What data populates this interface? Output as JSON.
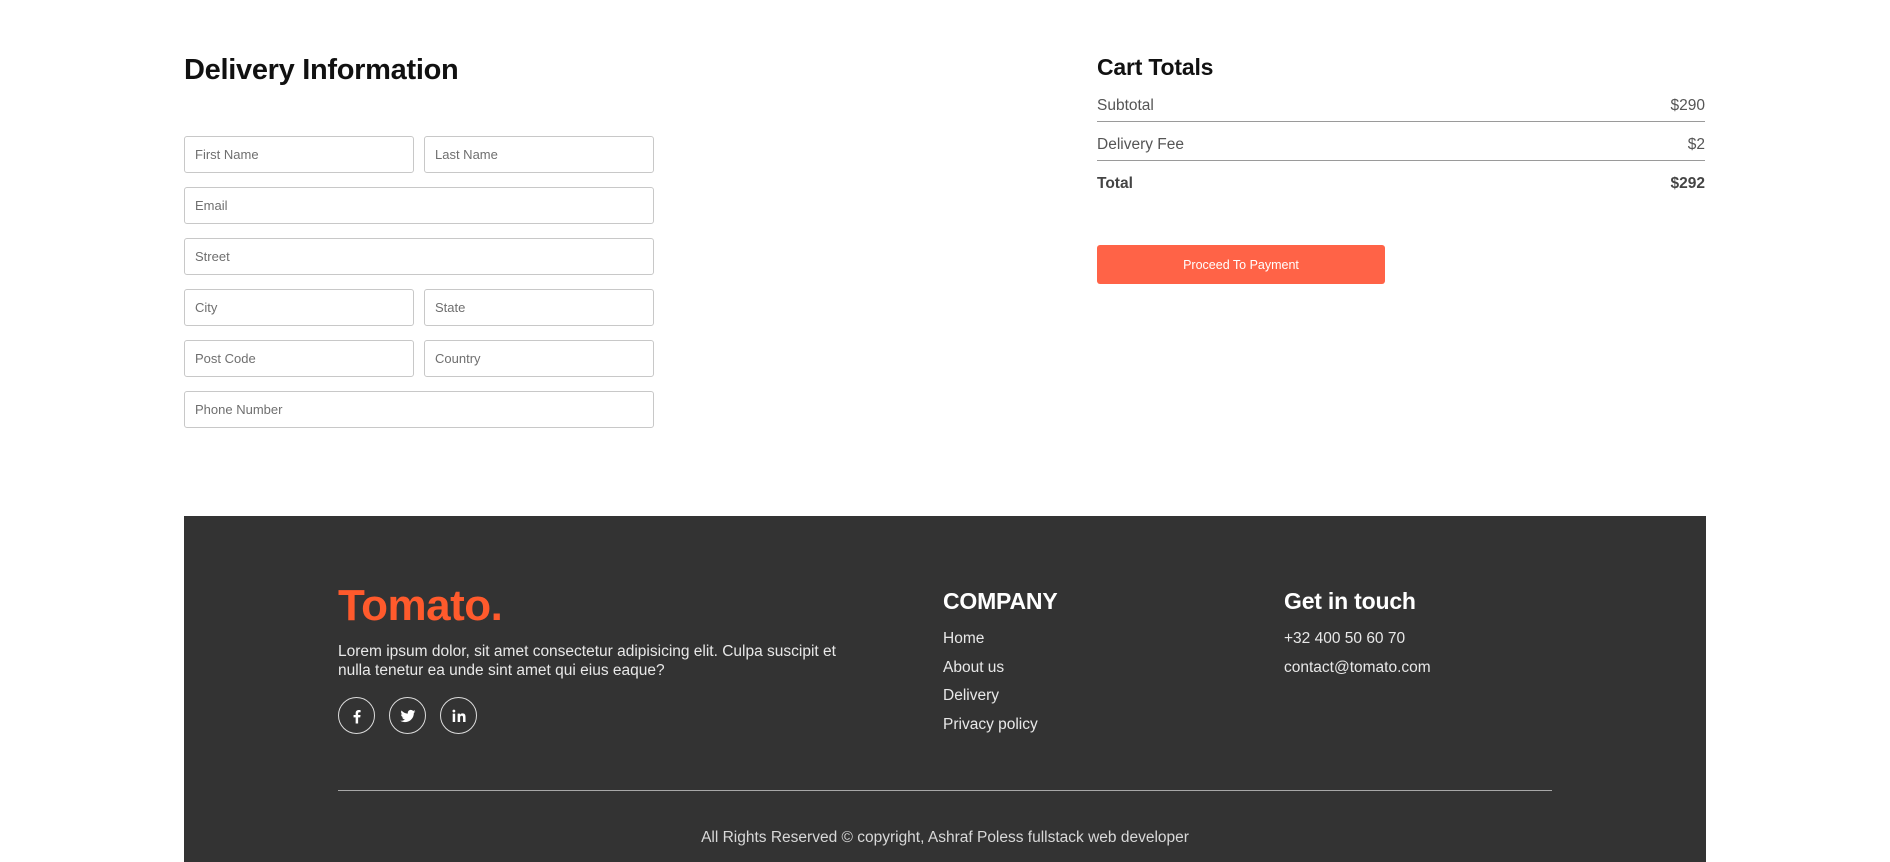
{
  "delivery": {
    "title": "Delivery Information",
    "fields": {
      "first_name": "First Name",
      "last_name": "Last Name",
      "email": "Email",
      "street": "Street",
      "city": "City",
      "state": "State",
      "post_code": "Post Code",
      "country": "Country",
      "phone": "Phone Number"
    }
  },
  "cart": {
    "title": "Cart Totals",
    "subtotal_label": "Subtotal",
    "subtotal_value": "$290",
    "fee_label": "Delivery Fee",
    "fee_value": "$2",
    "total_label": "Total",
    "total_value": "$292",
    "button_label": "Proceed To Payment"
  },
  "footer": {
    "brand": "Tomato.",
    "description": "Lorem ipsum dolor, sit amet consectetur adipisicing elit. Culpa suscipit et nulla tenetur ea unde sint amet qui eius eaque?",
    "socials": [
      "facebook-icon",
      "twitter-icon",
      "linkedin-icon"
    ],
    "company": {
      "title": "COMPANY",
      "links": [
        "Home",
        "About us",
        "Delivery",
        "Privacy policy"
      ]
    },
    "contact": {
      "title": "Get in touch",
      "phone": "+32 400 50 60 70",
      "email": "contact@tomato.com"
    },
    "copyright": "All Rights Reserved © copyright, Ashraf Poless fullstack web developer"
  },
  "colors": {
    "accent": "#ff6347",
    "brand": "#ff5a2c",
    "footer_bg": "#333333"
  }
}
